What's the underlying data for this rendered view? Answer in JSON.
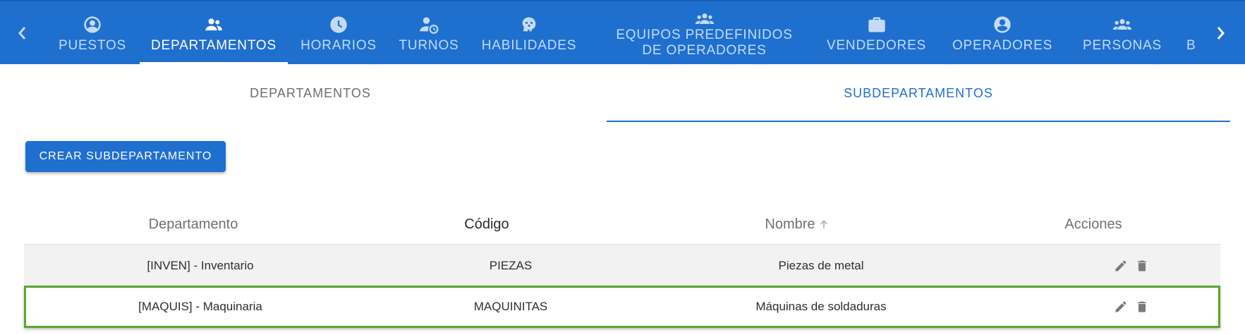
{
  "nav": {
    "prev_icon": "chevron-left-icon",
    "next_icon": "chevron-right-icon",
    "tabs": [
      {
        "label": "PUESTOS",
        "icon": "account-circle-icon"
      },
      {
        "label": "DEPARTAMENTOS",
        "icon": "group-icon",
        "active": true
      },
      {
        "label": "HORARIOS",
        "icon": "clock-icon"
      },
      {
        "label": "TURNOS",
        "icon": "person-clock-icon"
      },
      {
        "label": "HABILIDADES",
        "icon": "brain-icon"
      },
      {
        "label_line1": "EQUIPOS PREDEFINIDOS",
        "label_line2": "DE OPERADORES",
        "icon": "groups-icon"
      },
      {
        "label": "VENDEDORES",
        "icon": "briefcase-icon"
      },
      {
        "label": "OPERADORES",
        "icon": "account-circle-icon"
      },
      {
        "label": "PERSONAS",
        "icon": "people-icon"
      },
      {
        "label": "BR",
        "icon": ""
      }
    ]
  },
  "subtabs": [
    {
      "label": "DEPARTAMENTOS"
    },
    {
      "label": "SUBDEPARTAMENTOS",
      "active": true
    }
  ],
  "create_button": {
    "label": "CREAR SUBDEPARTAMENTO"
  },
  "table": {
    "columns": [
      "Departamento",
      "Código",
      "Nombre",
      "Acciones"
    ],
    "sort_icon": "arrow-up-icon",
    "rows": [
      {
        "departamento": "[INVEN] - Inventario",
        "codigo": "PIEZAS",
        "nombre": "Piezas de metal"
      },
      {
        "departamento": "[MAQUIS] - Maquinaria",
        "codigo": "MAQUINITAS",
        "nombre": "Máquinas de soldaduras",
        "selected": true
      }
    ],
    "row_actions": [
      "pencil-icon",
      "trash-icon"
    ]
  },
  "colors": {
    "primary": "#1f6fcf",
    "selection_outline": "#5aa531"
  }
}
